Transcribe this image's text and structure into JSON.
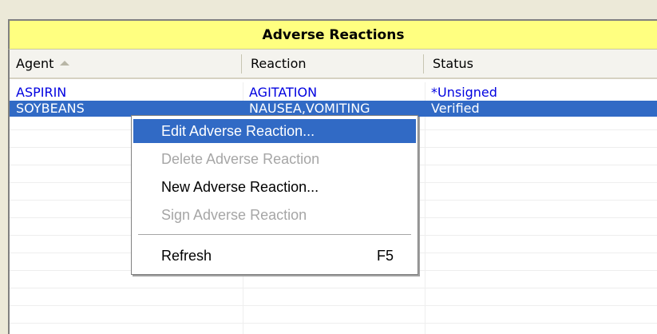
{
  "panel": {
    "title": "Adverse Reactions"
  },
  "columns": [
    {
      "label": "Agent",
      "sorted": "ascending"
    },
    {
      "label": "Reaction"
    },
    {
      "label": "Status"
    }
  ],
  "rows": [
    {
      "agent": "ASPIRIN",
      "reaction": "AGITATION",
      "status": "*Unsigned",
      "state": "normal"
    },
    {
      "agent": "SOYBEANS",
      "reaction": "NAUSEA,VOMITING",
      "status": "Verified",
      "state": "selected"
    }
  ],
  "context_menu": {
    "items": [
      {
        "label": "Edit Adverse Reaction...",
        "enabled": true,
        "highlighted": true
      },
      {
        "label": "Delete Adverse Reaction",
        "enabled": false
      },
      {
        "label": "New Adverse Reaction...",
        "enabled": true
      },
      {
        "label": "Sign Adverse Reaction",
        "enabled": false
      },
      {
        "label": "Refresh",
        "enabled": true,
        "shortcut": "F5"
      }
    ]
  },
  "colors": {
    "title_bg": "#ffff80",
    "selection": "#316ac5",
    "link_text": "#0000e0",
    "disabled_text": "#a6a6a6"
  }
}
